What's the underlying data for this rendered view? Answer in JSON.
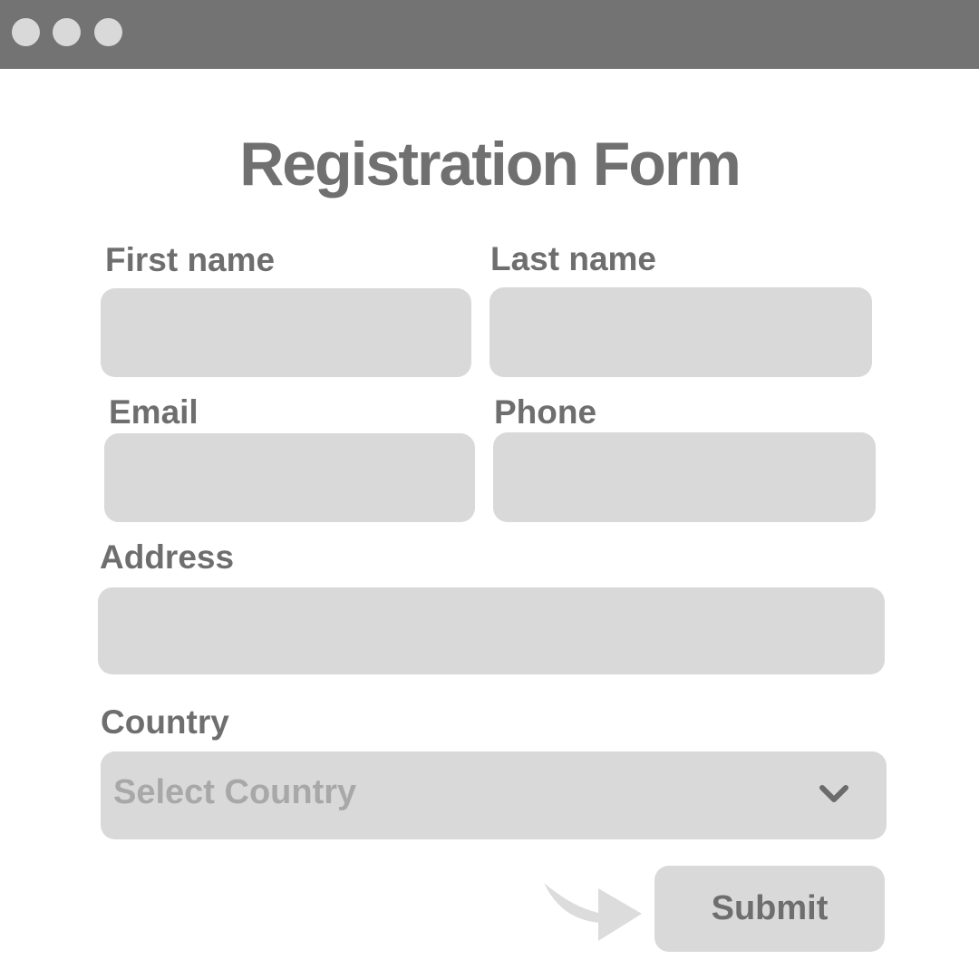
{
  "window": {
    "controls": [
      "window-dot",
      "window-dot",
      "window-dot"
    ]
  },
  "form": {
    "title": "Registration Form",
    "first_name": {
      "label": "First name",
      "value": ""
    },
    "last_name": {
      "label": "Last name",
      "value": ""
    },
    "email": {
      "label": "Email",
      "value": ""
    },
    "phone": {
      "label": "Phone",
      "value": ""
    },
    "address": {
      "label": "Address",
      "value": ""
    },
    "country": {
      "label": "Country",
      "placeholder": "Select Country",
      "icon": "chevron-down-icon"
    },
    "submit_label": "Submit",
    "pointer_icon": "curved-arrow-icon"
  },
  "colors": {
    "titlebar": "#737373",
    "field": "#d9d9d9",
    "text": "#707070",
    "placeholder": "#a8a8a8"
  }
}
